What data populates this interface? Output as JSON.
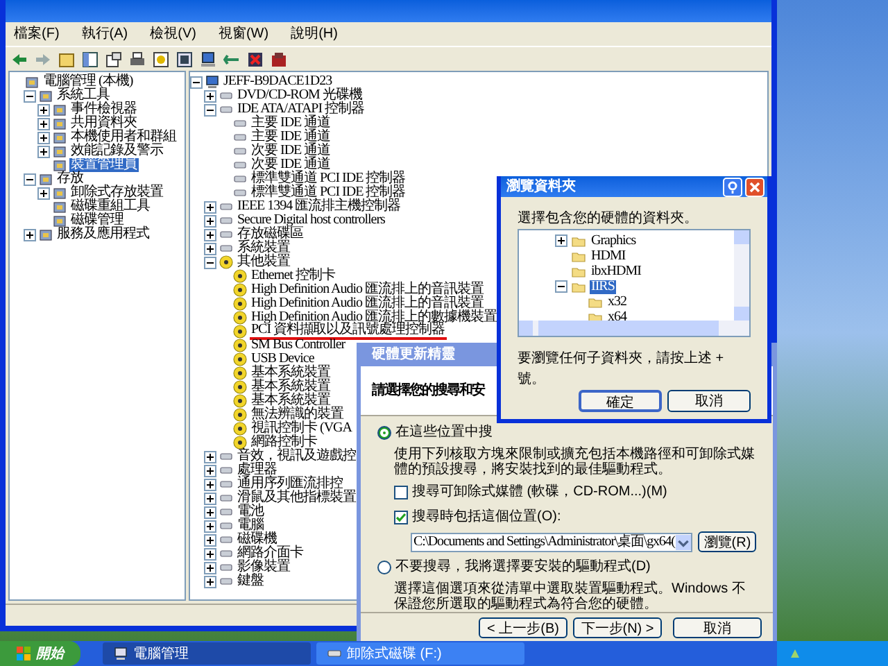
{
  "menu": [
    "檔案(F)",
    "執行(A)",
    "檢視(V)",
    "視窗(W)",
    "說明(H)"
  ],
  "left_tree": [
    {
      "label": "電腦管理 (本機)",
      "selected": false,
      "children": [
        {
          "label": "系統工具",
          "expanded": true,
          "selected": false,
          "children": [
            {
              "label": "事件檢視器",
              "expanded": false,
              "selected": false
            },
            {
              "label": "共用資料夾",
              "expanded": false,
              "selected": false
            },
            {
              "label": "本機使用者和群組",
              "expanded": false,
              "selected": false
            },
            {
              "label": "效能記錄及警示",
              "expanded": false,
              "selected": false
            },
            {
              "label": "裝置管理員",
              "selected": true
            }
          ]
        },
        {
          "label": "存放",
          "expanded": true,
          "selected": false,
          "children": [
            {
              "label": "卸除式存放裝置",
              "expanded": false,
              "selected": false
            },
            {
              "label": "磁碟重組工具",
              "selected": false
            },
            {
              "label": "磁碟管理",
              "selected": false
            }
          ]
        },
        {
          "label": "服務及應用程式",
          "expanded": false,
          "selected": false
        }
      ]
    }
  ],
  "device_tree": [
    {
      "label": "JEFF-B9DACE1D23",
      "kind": "computer",
      "expanded": true,
      "selected": false,
      "children": [
        {
          "label": "DVD/CD-ROM 光碟機",
          "kind": "device",
          "expanded": false,
          "selected": false
        },
        {
          "label": "IDE ATA/ATAPI 控制器",
          "kind": "device",
          "expanded": true,
          "selected": false,
          "children": [
            {
              "label": "主要 IDE 通道",
              "kind": "device",
              "selected": false
            },
            {
              "label": "主要 IDE 通道",
              "kind": "device",
              "selected": false
            },
            {
              "label": "次要 IDE 通道",
              "kind": "device",
              "selected": false
            },
            {
              "label": "次要 IDE 通道",
              "kind": "device",
              "selected": false
            },
            {
              "label": "標準雙通道 PCI IDE 控制器",
              "kind": "device",
              "selected": false
            },
            {
              "label": "標準雙通道 PCI IDE 控制器",
              "kind": "device",
              "selected": false
            }
          ]
        },
        {
          "label": "IEEE 1394 匯流排主機控制器",
          "kind": "device",
          "expanded": false,
          "selected": false
        },
        {
          "label": "Secure Digital host controllers",
          "kind": "device",
          "expanded": false,
          "selected": false
        },
        {
          "label": "存放磁碟區",
          "kind": "device",
          "expanded": false,
          "selected": false
        },
        {
          "label": "系統裝置",
          "kind": "device",
          "expanded": false,
          "selected": false
        },
        {
          "label": "其他裝置",
          "kind": "unknown",
          "expanded": true,
          "selected": false,
          "children": [
            {
              "label": "Ethernet 控制卡",
              "kind": "unknown",
              "selected": false,
              "underlined": false
            },
            {
              "label": "High Definition Audio 匯流排上的音訊裝置",
              "kind": "unknown",
              "selected": false,
              "underlined": false
            },
            {
              "label": "High Definition Audio 匯流排上的音訊裝置",
              "kind": "unknown",
              "selected": false,
              "underlined": false
            },
            {
              "label": "High Definition Audio 匯流排上的數據機裝置",
              "kind": "unknown",
              "selected": false,
              "underlined": false
            },
            {
              "label": "PCI 資料擷取以及訊號處理控制器",
              "kind": "unknown",
              "selected": false,
              "underlined": true
            },
            {
              "label": "SM Bus Controller",
              "kind": "unknown",
              "selected": false,
              "underlined": false
            },
            {
              "label": "USB Device",
              "kind": "unknown",
              "selected": false,
              "underlined": false
            },
            {
              "label": "基本系統裝置",
              "kind": "unknown",
              "selected": false,
              "underlined": false
            },
            {
              "label": "基本系統裝置",
              "kind": "unknown",
              "selected": false,
              "underlined": false
            },
            {
              "label": "基本系統裝置",
              "kind": "unknown",
              "selected": false,
              "underlined": false
            },
            {
              "label": "無法辨識的裝置",
              "kind": "unknown",
              "selected": false,
              "underlined": false
            },
            {
              "label": "視訊控制卡 (VGA",
              "kind": "unknown",
              "selected": false,
              "underlined": false
            },
            {
              "label": "網路控制卡",
              "kind": "unknown",
              "selected": false,
              "underlined": false
            }
          ]
        },
        {
          "label": "音效，視訊及遊戲控",
          "kind": "device",
          "expanded": false,
          "selected": false
        },
        {
          "label": "處理器",
          "kind": "device",
          "expanded": false,
          "selected": false
        },
        {
          "label": "通用序列匯流排控",
          "kind": "device",
          "expanded": false,
          "selected": false
        },
        {
          "label": "滑鼠及其他指標裝置",
          "kind": "device",
          "expanded": false,
          "selected": false
        },
        {
          "label": "電池",
          "kind": "device",
          "expanded": false,
          "selected": false
        },
        {
          "label": "電腦",
          "kind": "device",
          "expanded": false,
          "selected": false
        },
        {
          "label": "磁碟機",
          "kind": "device",
          "expanded": false,
          "selected": false
        },
        {
          "label": "網路介面卡",
          "kind": "device",
          "expanded": false,
          "selected": false
        },
        {
          "label": "影像裝置",
          "kind": "device",
          "expanded": false,
          "selected": false
        },
        {
          "label": "鍵盤",
          "kind": "device",
          "expanded": false,
          "selected": false
        }
      ]
    }
  ],
  "browse_dialog": {
    "title": "瀏覽資料夾",
    "prompt": "選擇包含您的硬體的資料夾。",
    "folders": [
      {
        "label": "Graphics",
        "expanded": false,
        "selected": false
      },
      {
        "label": "HDMI",
        "selected": false
      },
      {
        "label": "ibxHDMI",
        "selected": false
      },
      {
        "label": "IIRS",
        "expanded": true,
        "selected": true,
        "children": [
          {
            "label": "x32",
            "selected": false
          },
          {
            "label": "x64",
            "selected": false
          }
        ]
      }
    ],
    "hint": "要瀏覽任何子資料夾，請按上述 + 號。",
    "buttons": [
      "確定",
      "取消"
    ]
  },
  "wizard": {
    "title": "硬體更新精靈",
    "heading": "請選擇您的搜尋和安",
    "options": [
      {
        "label": "在這些位置中搜",
        "selected": true,
        "description": "使用下列核取方塊來限制或擴充包括本機路徑和可卸除式媒體的預設搜尋，將安裝找到的最佳驅動程式。"
      },
      {
        "label": "不要搜尋，我將選擇要安裝的驅動程式(D)",
        "selected": false,
        "description": "選擇這個選項來從清單中選取裝置驅動程式。Windows 不保證您所選取的驅動程式為符合您的硬體。"
      }
    ],
    "checkboxes": [
      {
        "label": "搜尋可卸除式媒體 (軟碟，CD-ROM...)(M)",
        "checked": false
      },
      {
        "label": "搜尋時包括這個位置(O):",
        "checked": true
      }
    ],
    "path": "C:\\Documents and Settings\\Administrator\\桌面\\gx64(",
    "browse_button": "瀏覽(R)",
    "buttons": [
      "< 上一步(B)",
      "下一步(N) >",
      "取消"
    ]
  },
  "taskbar": {
    "start": "開始",
    "tasks": [
      {
        "label": "電腦管理",
        "selected": true
      },
      {
        "label": "卸除式磁碟 (F:)",
        "selected": false
      }
    ]
  }
}
